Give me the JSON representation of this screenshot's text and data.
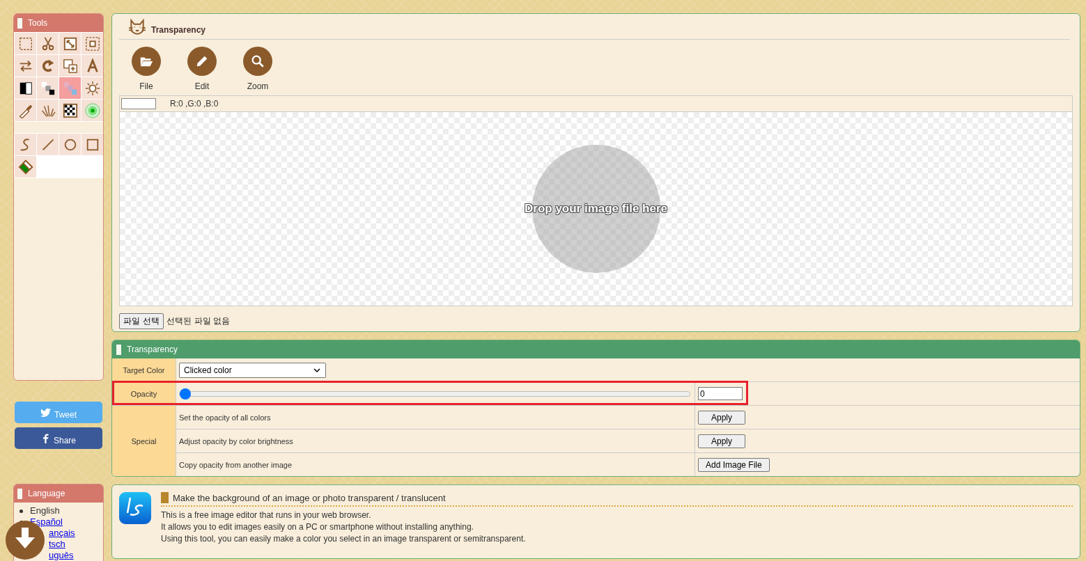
{
  "tools": {
    "title": "Tools",
    "groups": [
      [
        {
          "kind": "marquee",
          "selected": false
        },
        {
          "kind": "scissors",
          "selected": false
        },
        {
          "kind": "resize",
          "selected": false
        },
        {
          "kind": "crop",
          "selected": false
        },
        {
          "kind": "swap",
          "selected": false
        },
        {
          "kind": "rotate",
          "selected": false
        },
        {
          "kind": "duplicate",
          "selected": false
        },
        {
          "kind": "text",
          "selected": false
        },
        {
          "kind": "contrast",
          "selected": false
        },
        {
          "kind": "grayscale",
          "selected": false
        },
        {
          "kind": "transparency",
          "selected": true
        },
        {
          "kind": "brightness",
          "selected": false
        },
        {
          "kind": "eyedropper",
          "selected": false
        },
        {
          "kind": "spray",
          "selected": false
        },
        {
          "kind": "checker",
          "selected": false
        },
        {
          "kind": "glow",
          "selected": false
        }
      ],
      [
        {
          "kind": "curve",
          "selected": false
        },
        {
          "kind": "line",
          "selected": false
        },
        {
          "kind": "circle",
          "selected": false
        },
        {
          "kind": "rectangle",
          "selected": false
        },
        {
          "kind": "eraser",
          "selected": false
        }
      ]
    ]
  },
  "social": [
    {
      "kind": "tweet",
      "label": "Tweet"
    },
    {
      "kind": "share",
      "label": "Share"
    }
  ],
  "language": {
    "title": "Language",
    "items": [
      {
        "label": "English",
        "selected": true
      },
      {
        "label": "Español",
        "selected": false
      },
      {
        "label": "ançais",
        "selected": false
      },
      {
        "label": "tsch",
        "selected": false
      },
      {
        "label": "uguês",
        "selected": false
      }
    ]
  },
  "editor": {
    "title": "Transparency",
    "actions": [
      {
        "kind": "folder",
        "label": "File"
      },
      {
        "kind": "pencil",
        "label": "Edit"
      },
      {
        "kind": "search",
        "label": "Zoom"
      }
    ],
    "color_readout": "R:0 ,G:0 ,B:0",
    "drop_hint": "Drop your image file here",
    "file_button": "파일 선택",
    "file_status": "선택된 파일 없음"
  },
  "transparency": {
    "title": "Transparency",
    "rows": [
      {
        "kind": "select",
        "label": "Target Color",
        "value": "Clicked color",
        "highlighted": false
      },
      {
        "kind": "slider",
        "label": "Opacity",
        "level": 0,
        "value": "0",
        "highlighted": true
      },
      {
        "kind": "actions",
        "label": "Special",
        "highlighted": false,
        "items": [
          {
            "text": "Set the opacity of all colors",
            "button": "Apply"
          },
          {
            "text": "Adjust opacity by color brightness",
            "button": "Apply"
          },
          {
            "text": "Copy opacity from another image",
            "button": "Add Image File"
          }
        ]
      }
    ]
  },
  "info": {
    "heading": "Make the background of an image or photo transparent / translucent",
    "paragraphs": [
      "This is a free image editor that runs in your web browser.",
      "It allows you to edit images easily on a PC or smartphone without installing anything.",
      "Using this tool, you can easily make a color you select in an image transparent or semitransparent."
    ]
  }
}
